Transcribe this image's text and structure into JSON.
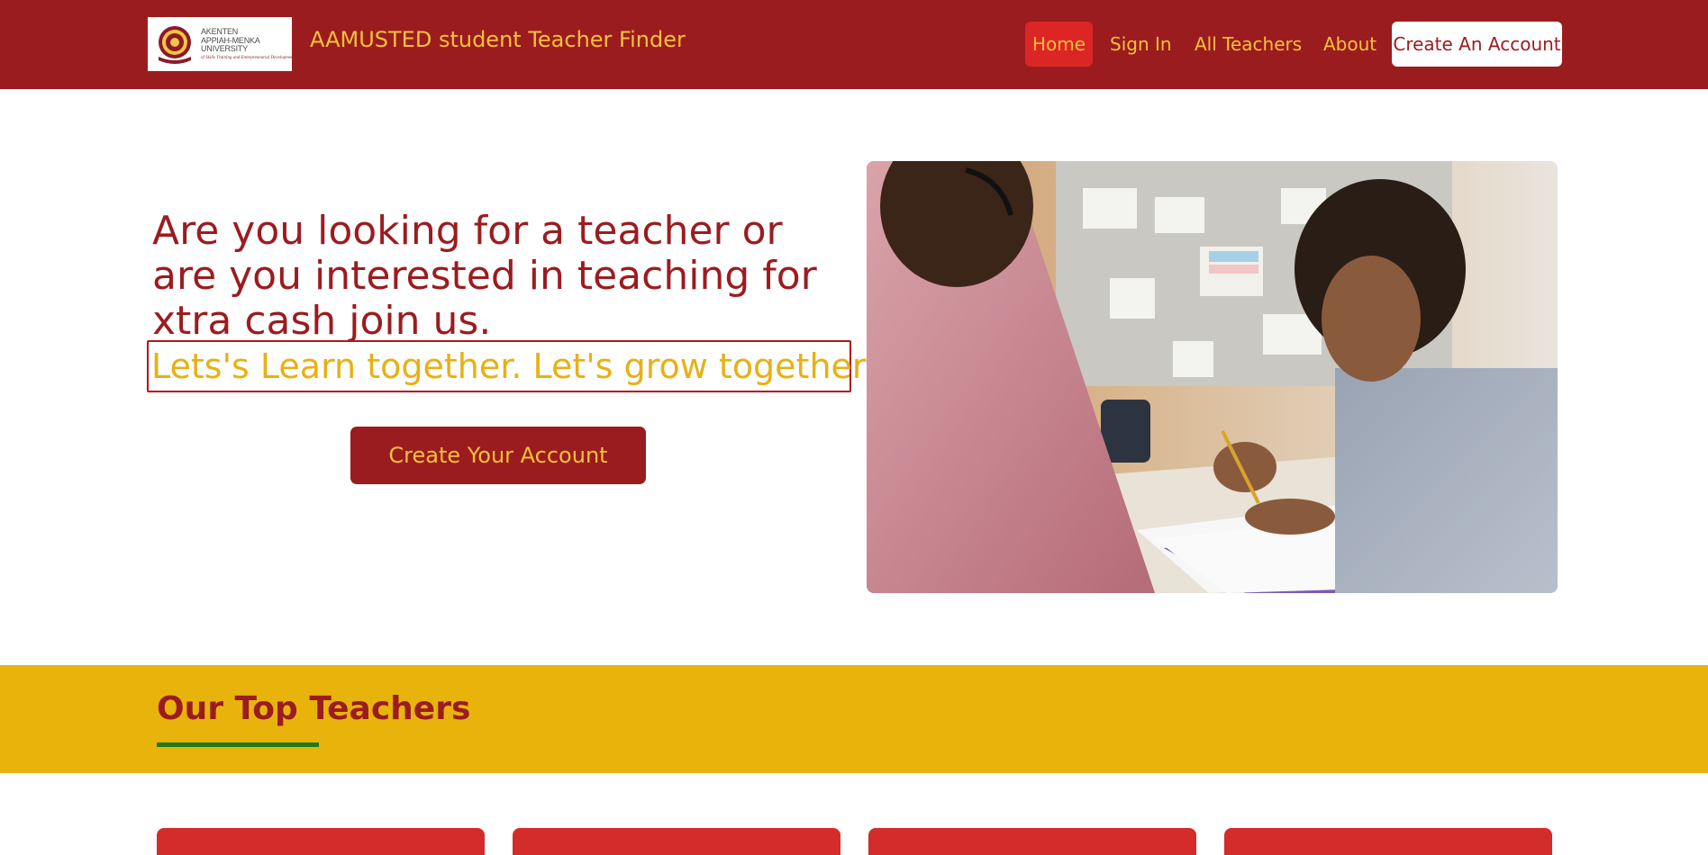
{
  "navbar": {
    "logo": {
      "lines": [
        "AKENTEN",
        "APPIAH-MENKA",
        "UNIVERSITY"
      ],
      "tagline": "of Skills Training and Entrepreneurial Development"
    },
    "brand": "AAMUSTED student Teacher Finder",
    "items": [
      {
        "label": "Home",
        "active": true
      },
      {
        "label": "Sign In"
      },
      {
        "label": "All Teachers"
      },
      {
        "label": "About"
      }
    ],
    "cta": "Create An Account"
  },
  "hero": {
    "heading": "Are you looking for a teacher or are you interested in teaching for xtra cash join us.",
    "tagline": "Lets's Learn together. Let's grow together.",
    "cta": "Create Your Account",
    "image_icon": "tutoring-photo"
  },
  "top_teachers": {
    "title": "Our Top Teachers",
    "cards": [
      {},
      {},
      {},
      {}
    ]
  },
  "colors": {
    "primary": "#9b1c1f",
    "accent": "#f5c13a",
    "active": "#dc2626",
    "band": "#e8b30b",
    "underline": "#1f7a1f",
    "card": "#d42b2b"
  }
}
